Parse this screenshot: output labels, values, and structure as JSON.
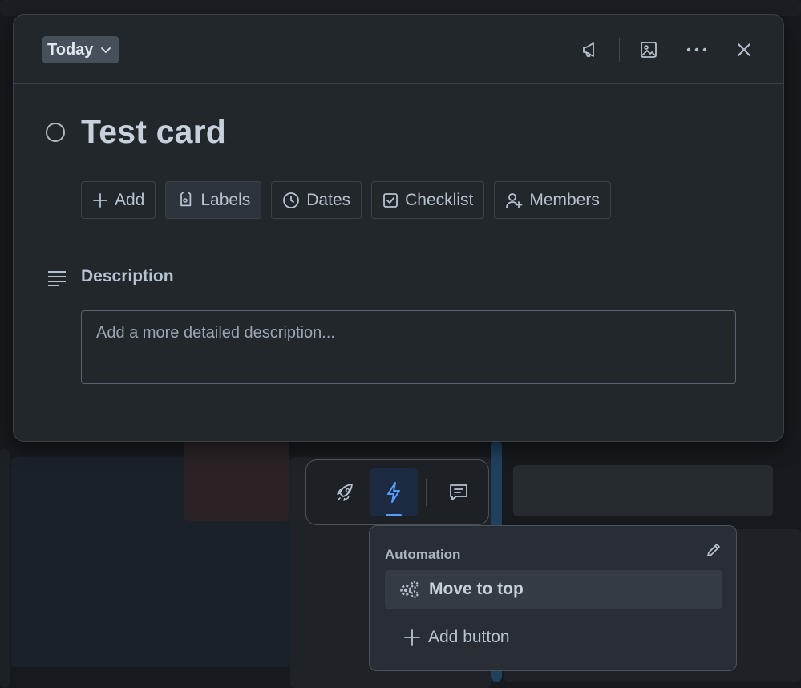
{
  "header": {
    "list_name": "Today"
  },
  "card": {
    "title": "Test card"
  },
  "actions": [
    {
      "label": "Add",
      "icon": "plus-icon"
    },
    {
      "label": "Labels",
      "icon": "tag-icon"
    },
    {
      "label": "Dates",
      "icon": "clock-icon"
    },
    {
      "label": "Checklist",
      "icon": "checkbox-icon"
    },
    {
      "label": "Members",
      "icon": "add-member-icon"
    }
  ],
  "description": {
    "heading": "Description",
    "placeholder": "Add a more detailed description..."
  },
  "automation": {
    "title": "Automation",
    "button_label": "Move to top",
    "add_label": "Add button"
  },
  "colors": {
    "modal_bg": "#22272b",
    "accent": "#579dff",
    "panel_bg": "#282e33"
  }
}
